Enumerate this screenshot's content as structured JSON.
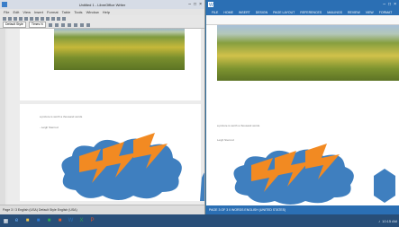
{
  "left_window": {
    "title": "Untitled 1 - LibreOffice Writer",
    "menus": [
      "File",
      "Edit",
      "View",
      "Insert",
      "Format",
      "Table",
      "Tools",
      "Window",
      "Help"
    ],
    "style_combo": "Default Style",
    "font_combo": "Times N",
    "page_text_1": "a picture is worth a thousand words",
    "page_text_2": "- Leigh Stenrod",
    "status_text": "Page 3 / 3   English (USA)   Default Style  English (USA)"
  },
  "right_window": {
    "ribbon_tabs": [
      "FILE",
      "HOME",
      "INSERT",
      "DESIGN",
      "PAGE LAYOUT",
      "REFERENCES",
      "MAILINGS",
      "REVIEW",
      "VIEW",
      "FORMAT"
    ],
    "page_text_1": "a picture is worth a thousand words",
    "page_text_2": "Leigh Stenrod",
    "status_text": "PAGE 3 OF 3   0 WORDS   ENGLISH (UNITED STATES)"
  },
  "taskbar": {
    "start": "start-icon",
    "apps": [
      "ie-icon",
      "folder-icon",
      "writer-icon",
      "calc-icon",
      "impress-icon",
      "word-icon",
      "excel-icon",
      "powerpoint-icon"
    ],
    "time": "10:15 AM"
  },
  "colors": {
    "cloud": "#3f7fbf",
    "lightning": "#f28a22",
    "word_blue": "#2b6fb4",
    "taskbar": "#284e78"
  }
}
